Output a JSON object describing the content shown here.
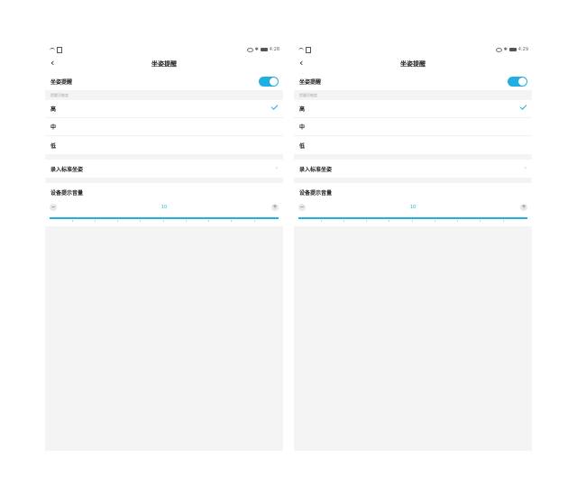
{
  "screens": [
    {
      "status": {
        "time": "4:28"
      },
      "nav_title": "坐姿提醒",
      "reminder_label": "坐姿提醒",
      "reminder_on": true,
      "sensitivity_label": "提醒灵敏度",
      "levels": [
        "高",
        "中",
        "低"
      ],
      "selected_level": "高",
      "record_label": "录入标准坐姿",
      "volume_label": "设备提示音量",
      "volume_value": "10",
      "minus": "−",
      "plus": "+"
    },
    {
      "status": {
        "time": "4:29"
      },
      "nav_title": "坐姿提醒",
      "reminder_label": "坐姿提醒",
      "reminder_on": true,
      "sensitivity_label": "提醒灵敏度",
      "levels": [
        "高",
        "中",
        "低"
      ],
      "selected_level": "高",
      "record_label": "录入标准坐姿",
      "volume_label": "设备提示音量",
      "volume_value": "10",
      "minus": "−",
      "plus": "+"
    }
  ],
  "colors": {
    "accent": "#21aee0",
    "background": "#f4f4f4"
  },
  "icons": [
    "wifi-icon",
    "sim-icon",
    "eye-icon",
    "bluetooth-icon",
    "battery-icon",
    "back-icon",
    "check-icon",
    "chevron-right-icon"
  ]
}
